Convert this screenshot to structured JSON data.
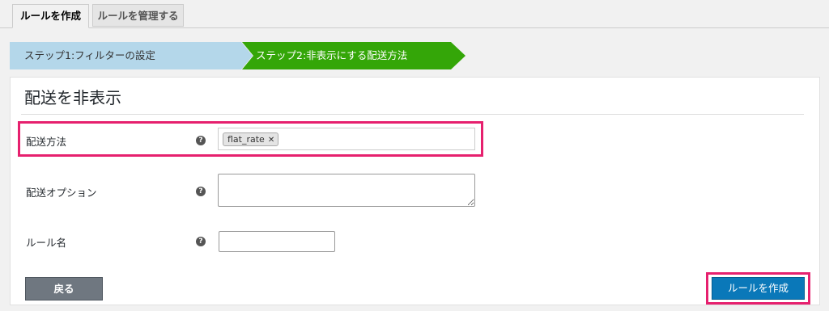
{
  "tabs": {
    "create_label": "ルールを作成",
    "manage_label": "ルールを管理する"
  },
  "stepper": {
    "step1_label": "ステップ1:フィルターの設定",
    "step2_label": "ステップ2:非表示にする配送方法"
  },
  "panel": {
    "title": "配送を非表示",
    "fields": {
      "method": {
        "label": "配送方法",
        "help_icon": "?",
        "selected_tags": [
          "flat_rate"
        ],
        "tag_remove_glyph": "✕"
      },
      "option": {
        "label": "配送オプション",
        "help_icon": "?",
        "value": ""
      },
      "rule_name": {
        "label": "ルール名",
        "help_icon": "?",
        "value": ""
      }
    },
    "back_button": "戻る",
    "create_button": "ルールを作成"
  },
  "colors": {
    "step1_bg": "#b4d7ea",
    "step2_bg": "#34a608",
    "highlight": "#e6206e",
    "create_button_bg": "#0a78b9",
    "back_button_bg": "#6f7780"
  }
}
